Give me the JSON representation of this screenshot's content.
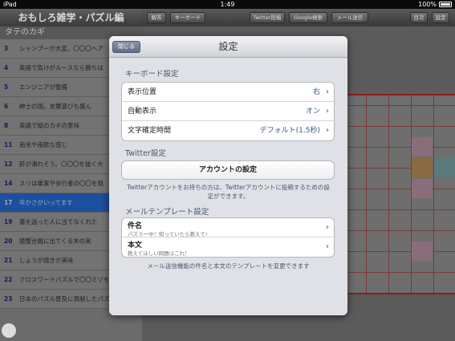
{
  "statusbar": {
    "device": "iPad",
    "time": "1:49",
    "battery": "100%"
  },
  "left": {
    "title": "おもしろ雑学・パズル編",
    "section": "タテのカギ",
    "clues": [
      {
        "num": "3",
        "text": "シャンプーが大変。〇〇〇ヘア"
      },
      {
        "num": "4",
        "text": "英語で負けがルースなら勝ちは"
      },
      {
        "num": "5",
        "text": "エンジニアが整備"
      },
      {
        "num": "6",
        "text": "紳士の国。言葉遊びも盛ん"
      },
      {
        "num": "8",
        "text": "英語で縦のカギの意味"
      },
      {
        "num": "11",
        "text": "南米や南欧な感じ"
      },
      {
        "num": "12",
        "text": "肝が潰れそう。〇〇〇を抜く大"
      },
      {
        "num": "14",
        "text": "スリは乗客や歩行者の〇〇を狙"
      },
      {
        "num": "17",
        "text": "年かさがいってます"
      },
      {
        "num": "19",
        "text": "著を送った人に当てなくれた"
      },
      {
        "num": "20",
        "text": "猿蟹合戦に出てくる木の実"
      },
      {
        "num": "21",
        "text": "しょうが焼きが美味"
      },
      {
        "num": "22",
        "text": "クロスワードパズルで〇〇ミゾを活性化"
      },
      {
        "num": "23",
        "text": "日本のパズル普及に貢献したパズル誌"
      }
    ]
  },
  "toolbar": {
    "answer": "解答",
    "keyboard": "キーボード",
    "twitter": "Twitter投稿",
    "google": "Google検索",
    "mail": "メール送信",
    "contents": "目次",
    "settings": "設定"
  },
  "modal": {
    "title": "設定",
    "close_label": "閉じる",
    "keyboard_section": "キーボード設定",
    "keyboard_rows": [
      {
        "label": "表示位置",
        "value": "右"
      },
      {
        "label": "自動表示",
        "value": "オン"
      },
      {
        "label": "文字確定時間",
        "value": "デフォルト(1.5秒)"
      }
    ],
    "twitter_section": "Twitter設定",
    "account_button": "アカウントの設定",
    "twitter_note": "Twitterアカウントをお持ちの方は、Twitterアカウントに投稿するための設定ができます。",
    "mail_section": "メールテンプレート設定",
    "mail_rows": [
      {
        "title": "件名",
        "subtitle": "パズラー中！知っていたら教えて!"
      },
      {
        "title": "本文",
        "subtitle": "教えてほしい問題はこれ！"
      }
    ],
    "mail_note": "メール送信機能の件名と本文のテンプレートを変更できます"
  }
}
